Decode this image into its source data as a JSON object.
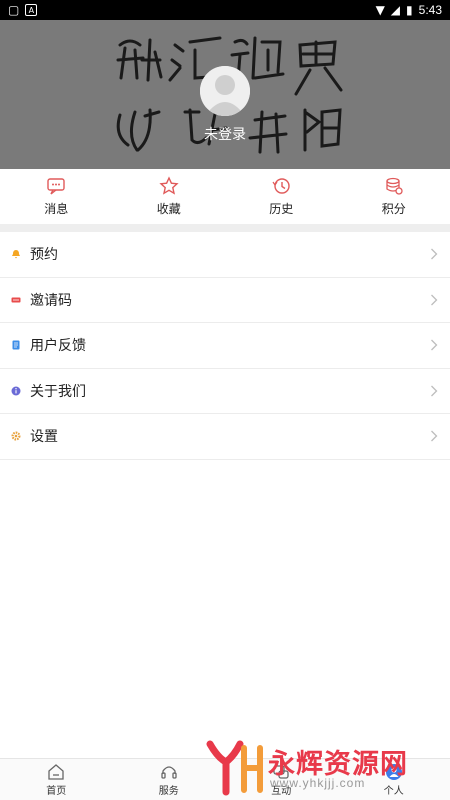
{
  "status_bar": {
    "time": "5:43"
  },
  "header": {
    "login_label": "未登录"
  },
  "quick_actions": [
    {
      "label": "消息",
      "icon": "message-icon"
    },
    {
      "label": "收藏",
      "icon": "star-icon"
    },
    {
      "label": "历史",
      "icon": "history-icon"
    },
    {
      "label": "积分",
      "icon": "coins-icon"
    }
  ],
  "menu": [
    {
      "label": "预约",
      "icon": "bell-icon",
      "color": "#f5a623"
    },
    {
      "label": "邀请码",
      "icon": "ticket-icon",
      "color": "#e84b4b"
    },
    {
      "label": "用户反馈",
      "icon": "feedback-icon",
      "color": "#3d8ee8"
    },
    {
      "label": "关于我们",
      "icon": "info-icon",
      "color": "#6b6bd6"
    },
    {
      "label": "设置",
      "icon": "gear-icon",
      "color": "#e8a23d"
    }
  ],
  "bottom_nav": [
    {
      "label": "首页",
      "icon": "home-icon"
    },
    {
      "label": "服务",
      "icon": "headset-icon"
    },
    {
      "label": "互动",
      "icon": "interact-icon"
    },
    {
      "label": "个人",
      "icon": "user-icon"
    }
  ],
  "watermark": {
    "title": "永辉资源网",
    "url": "www.yhkjjj.com"
  },
  "colors": {
    "accent": "#e8394a",
    "header_bg": "#7a7a7a"
  }
}
